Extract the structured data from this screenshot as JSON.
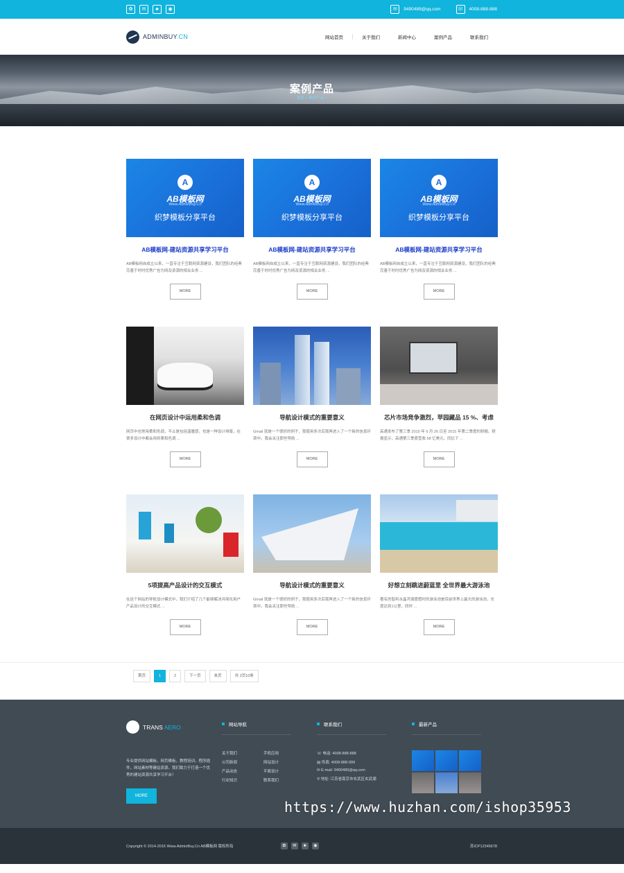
{
  "topbar": {
    "socials": [
      "✿",
      "✉",
      "♣",
      "◉"
    ],
    "email": "9490489@qq.com",
    "phone": "4008-888-888"
  },
  "header": {
    "logo_main": "ADMINBUY",
    "logo_suffix": ".CN",
    "nav": [
      "网站首页",
      "关于我们",
      "新闻中心",
      "案例产品",
      "联系我们"
    ]
  },
  "banner": {
    "title": "案例产品",
    "breadcrumb": "首页 > 案例产品 >"
  },
  "cards": [
    {
      "title": "AB模板网-建站资源共享学习平台",
      "desc": "AB模板网自成立以来，一直专注于互联网资源建设，我们团队的经典完善于时时优秀广告为网及资源的相关业务 ...",
      "more": "MORE",
      "thumb": "ab",
      "brand": "AB模板网",
      "url": "Www.AdminBuy.Cn",
      "slogan": "织梦模板分享平台"
    },
    {
      "title": "AB模板网-建站资源共享学习平台",
      "desc": "AB模板网自成立以来，一直专注于互联网资源建设，我们团队的经典完善于时时优秀广告为网及资源的相关业务 ...",
      "more": "MORE",
      "thumb": "ab",
      "brand": "AB模板网",
      "url": "Www.AdminBuy.Cn",
      "slogan": "织梦模板分享平台"
    },
    {
      "title": "AB模板网-建站资源共享学习平台",
      "desc": "AB模板网自成立以来，一直专注于互联网资源建设，我们团队的经典完善于时时优秀广告为网及资源的相关业务 ...",
      "more": "MORE",
      "thumb": "ab",
      "brand": "AB模板网",
      "url": "Www.AdminBuy.Cn",
      "slogan": "织梦模板分享平台"
    },
    {
      "title": "在网页设计中运用柔和色调",
      "desc": "网页中也常用柔和色调，不止是包括温暖感，也是一种设计排版，在很多设计中都会用到柔和色调 ...",
      "more": "MORE",
      "thumb": "ph1"
    },
    {
      "title": "导航设计模式的重要意义",
      "desc": "Gmail 就是一个很好的例子，我使用多次后我再进入了一个新的信息环境中，我会关注那些导航 ...",
      "more": "MORE",
      "thumb": "ph2"
    },
    {
      "title": "芯片市场竞争激烈，苹园藏品 15 %、考虑",
      "desc": "高通发布了第三季 2015 年 6 月 26 日至 2015 年第二季度的财报。财报显示，高通第三季度营收 58 亿美元，同比下 ...",
      "more": "MORE",
      "thumb": "ph3"
    },
    {
      "title": "5项提高产品设计的交互模式",
      "desc": "在这个网站的导航设计模式中，我们介绍了几个能够解决并简化用户产品设计的交互模式 ...",
      "more": "MORE",
      "thumb": "ph4"
    },
    {
      "title": "导航设计模式的重要意义",
      "desc": "Gmail 就是一个很好的例子，我使用多次后我再进入了一个新的信息环境中，我会关注那些导航 ...",
      "more": "MORE",
      "thumb": "ph5"
    },
    {
      "title": "好想立刻跳进蔚蓝里 全世界最大游泳池",
      "desc": "著名的智利水晶泻湖度假村的游泳池是目前世界上最大的游泳池，长度达到1公里，同时 ...",
      "more": "MORE",
      "thumb": "ph6"
    }
  ],
  "pagination": [
    "首页",
    "1",
    "2",
    "下一页",
    "末页",
    "共 2页10条"
  ],
  "footer": {
    "logo_main": "TRANS",
    "logo_suffix": " AERO",
    "desc": "专业提供网站模板，网页模板，教程培训，程序插件，网站素材等建站资源。我们致力于打造一个优秀的建站资源共享学习平台！",
    "button": "MORE",
    "nav_title": "网站导航",
    "nav_links": [
      "关于我们",
      "手机应用",
      "公司新闻",
      "网站设计",
      "产品动态",
      "平面设计",
      "行业知识",
      "联系我们"
    ],
    "contact_title": "联系我们",
    "contact": [
      "电话: 4008-888-888",
      "传真: 4008-888-999",
      "E-mail: 9490489@qq.com",
      "地址: 江苏省南京市玄武区玄武湖"
    ],
    "products_title": "最新产品"
  },
  "bottombar": {
    "copyright": "Copyright © 2014-2016 Www.AdminBuy.Cn AB模板网 版权所有",
    "icp": "苏ICP12345678"
  },
  "watermark": "https://www.huzhan.com/ishop35953"
}
